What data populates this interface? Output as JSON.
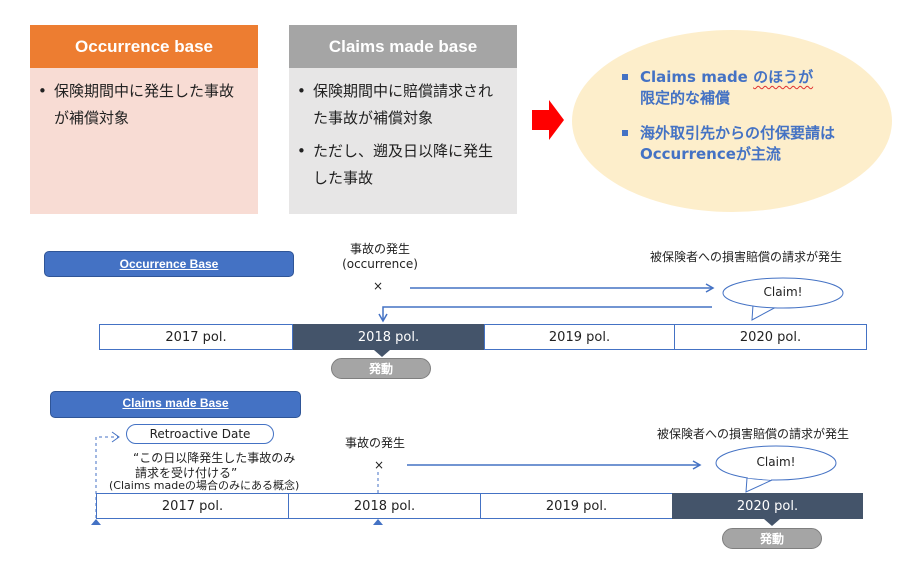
{
  "top": {
    "occurrence_card": {
      "title": "Occurrence base",
      "header_color": "#ed7d31",
      "body_color": "#f8dcd4",
      "bullets": [
        "保険期間中に発生した事故が補償対象"
      ]
    },
    "claims_card": {
      "title": "Claims made base",
      "header_color": "#a5a5a5",
      "body_color": "#e7e6e6",
      "bullets": [
        "保険期間中に賠償請求された事故が補償対象",
        "ただし、遡及日以降に発生した事故"
      ]
    },
    "arrow_color": "#ff0000",
    "conclusion": {
      "item1_a": "Claims made ",
      "item1_b": "のほうが",
      "item1_c": "限定的な補償",
      "item2": "海外取引先からの付保要請はOccurrenceが主流"
    }
  },
  "occurrence_timeline": {
    "title": "Occurrence Base",
    "event_label_line1": "事故の発生",
    "event_label_line2": "(occurrence)",
    "event_marker": "×",
    "claim_label": "被保険者への損害賠償の請求が発生",
    "claim_bubble": "Claim!",
    "policies": [
      "2017 pol.",
      "2018 pol.",
      "2019 pol.",
      "2020 pol."
    ],
    "active_policy_index": 1,
    "trigger_label": "発動"
  },
  "claims_timeline": {
    "title": "Claims made Base",
    "retroactive_label": "Retroactive Date",
    "retro_note_line1": "“この日以降発生した事故のみ",
    "retro_note_line2": "請求を受け付ける”",
    "retro_note_line3": "(Claims madeの場合のみにある概念)",
    "event_label": "事故の発生",
    "event_marker": "×",
    "claim_label": "被保険者への損害賠償の請求が発生",
    "claim_bubble": "Claim!",
    "policies": [
      "2017 pol.",
      "2018 pol.",
      "2019 pol.",
      "2020 pol."
    ],
    "active_policy_index": 3,
    "trigger_label": "発動"
  }
}
